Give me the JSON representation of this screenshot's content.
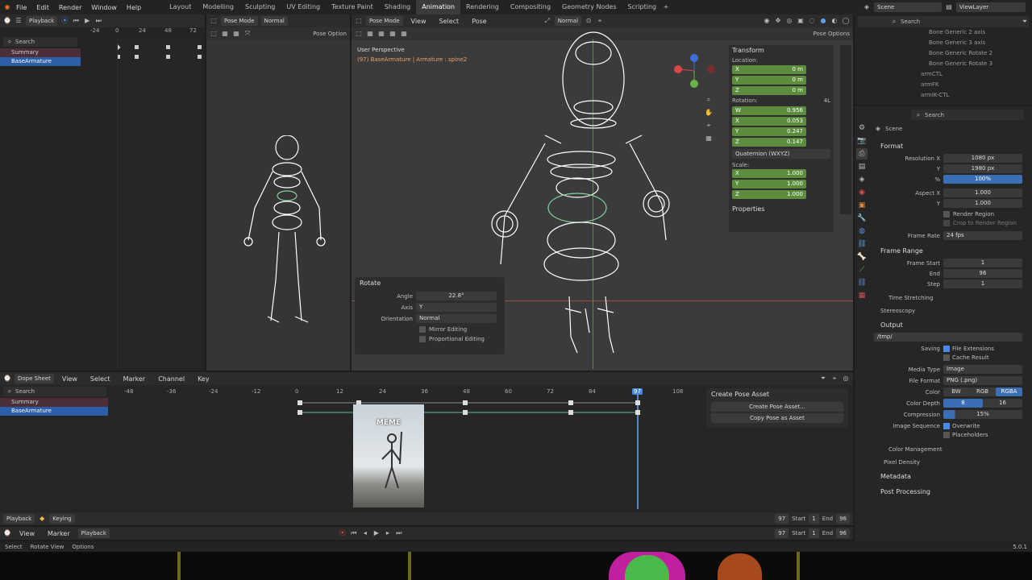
{
  "menus": [
    "File",
    "Edit",
    "Render",
    "Window",
    "Help"
  ],
  "workspaces": [
    "Layout",
    "Modelling",
    "Sculpting",
    "UV Editing",
    "Texture Paint",
    "Shading",
    "Animation",
    "Rendering",
    "Compositing",
    "Geometry Nodes",
    "Scripting"
  ],
  "active_workspace": "Animation",
  "scene": "Scene",
  "view_layer": "ViewLayer",
  "left_ts": {
    "playback": "Playback",
    "ticks": [
      "-24",
      "0",
      "24",
      "48",
      "72"
    ],
    "search": "Search",
    "rows": [
      "Summary",
      "BaseArmature"
    ]
  },
  "small_view": {
    "mode": "Pose Mode",
    "orientation": "Normal",
    "pose_options": "Pose Option"
  },
  "main_view": {
    "mode": "Pose Mode",
    "orientation": "Normal",
    "menus": [
      "View",
      "Select",
      "Pose"
    ],
    "perspective": "User Perspective",
    "object": "(97) BaseArmature | Armature : spine2",
    "pose_options": "Pose Options"
  },
  "transform": {
    "title": "Transform",
    "location": "Location:",
    "loc": [
      [
        "X",
        "0 m"
      ],
      [
        "Y",
        "0 m"
      ],
      [
        "Z",
        "0 m"
      ]
    ],
    "rotation": "Rotation:",
    "rot": [
      [
        "W",
        "0.956"
      ],
      [
        "X",
        "0.053"
      ],
      [
        "Y",
        "0.247"
      ],
      [
        "Z",
        "0.147"
      ]
    ],
    "rot_mode": "Quaternion (WXYZ)",
    "scale": "Scale:",
    "scl": [
      [
        "X",
        "1.000"
      ],
      [
        "Y",
        "1.000"
      ],
      [
        "Z",
        "1.000"
      ]
    ],
    "properties": "Properties",
    "badge": "4L"
  },
  "rotate_op": {
    "title": "Rotate",
    "angle_label": "Angle",
    "angle": "22.8°",
    "axis_label": "Axis",
    "axis": "Y",
    "orient_label": "Orientation",
    "orient": "Normal",
    "mirror": "Mirror Editing",
    "proportional": "Proportional Editing"
  },
  "outliner": {
    "search": "Search",
    "items": [
      "Bone Generic 2 axis",
      "Bone Generic 3 axis",
      "Bone Generic Rotate 2",
      "Bone Generic Rotate 3",
      "armCTL",
      "armFK",
      "armIK-CTL"
    ]
  },
  "props": {
    "search": "Search",
    "scene": "Scene",
    "format": {
      "title": "Format",
      "res_x_label": "Resolution X",
      "res_x": "1080 px",
      "y_label": "Y",
      "res_y": "1980 px",
      "pct_label": "%",
      "pct": "100%",
      "aspect_label": "Aspect X",
      "aspect_x": "1.000",
      "aspect_y": "1.000",
      "render_region": "Render Region",
      "crop": "Crop to Render Region",
      "fps_label": "Frame Rate",
      "fps": "24 fps"
    },
    "frame_range": {
      "title": "Frame Range",
      "start_label": "Frame Start",
      "start": "1",
      "end_label": "End",
      "end": "96",
      "step_label": "Step",
      "step": "1",
      "time_stretch": "Time Stretching",
      "stereo": "Stereoscopy"
    },
    "output": {
      "title": "Output",
      "path": "/tmp/",
      "saving": "Saving",
      "file_ext": "File Extensions",
      "cache": "Cache Result",
      "media_label": "Media Type",
      "media": "Image",
      "ff_label": "File Format",
      "ff": "PNG (.png)",
      "color_label": "Color",
      "bw": "BW",
      "rgb": "RGB",
      "rgba": "RGBA",
      "depth_label": "Color Depth",
      "d8": "8",
      "d16": "16",
      "comp_label": "Compression",
      "comp": "15%",
      "seq_label": "Image Sequence",
      "overwrite": "Overwrite",
      "placeholders": "Placeholders",
      "color_mgmt": "Color Management",
      "pixel_density": "Pixel Density",
      "metadata": "Metadata",
      "post": "Post Processing"
    }
  },
  "dopesheet": {
    "mode": "Dope Sheet",
    "menus": [
      "View",
      "Select",
      "Marker",
      "Channel",
      "Key"
    ],
    "search": "Search",
    "ticks": [
      "-48",
      "-36",
      "-24",
      "-12",
      "0",
      "12",
      "24",
      "36",
      "48",
      "60",
      "72",
      "84",
      "97",
      "108"
    ],
    "rows": [
      "Summary",
      "BaseArmature"
    ],
    "current": "97",
    "pose_asset": {
      "title": "Create Pose Asset",
      "create": "Create Pose Asset...",
      "copy": "Copy Pose as Asset"
    },
    "playback": "Playback",
    "keying": "Keying",
    "frame": "97",
    "start_label": "Start",
    "start": "1",
    "end_label": "End",
    "end": "96"
  },
  "meme": "MEME",
  "bottom_tl": {
    "menus": [
      "View",
      "Marker",
      "Playback"
    ],
    "frame": "97",
    "start_label": "Start",
    "start": "1",
    "end_label": "End",
    "end": "96"
  },
  "status": {
    "select": "Select",
    "rotate_view": "Rotate View",
    "options": "Options",
    "version": "5.0.1"
  }
}
